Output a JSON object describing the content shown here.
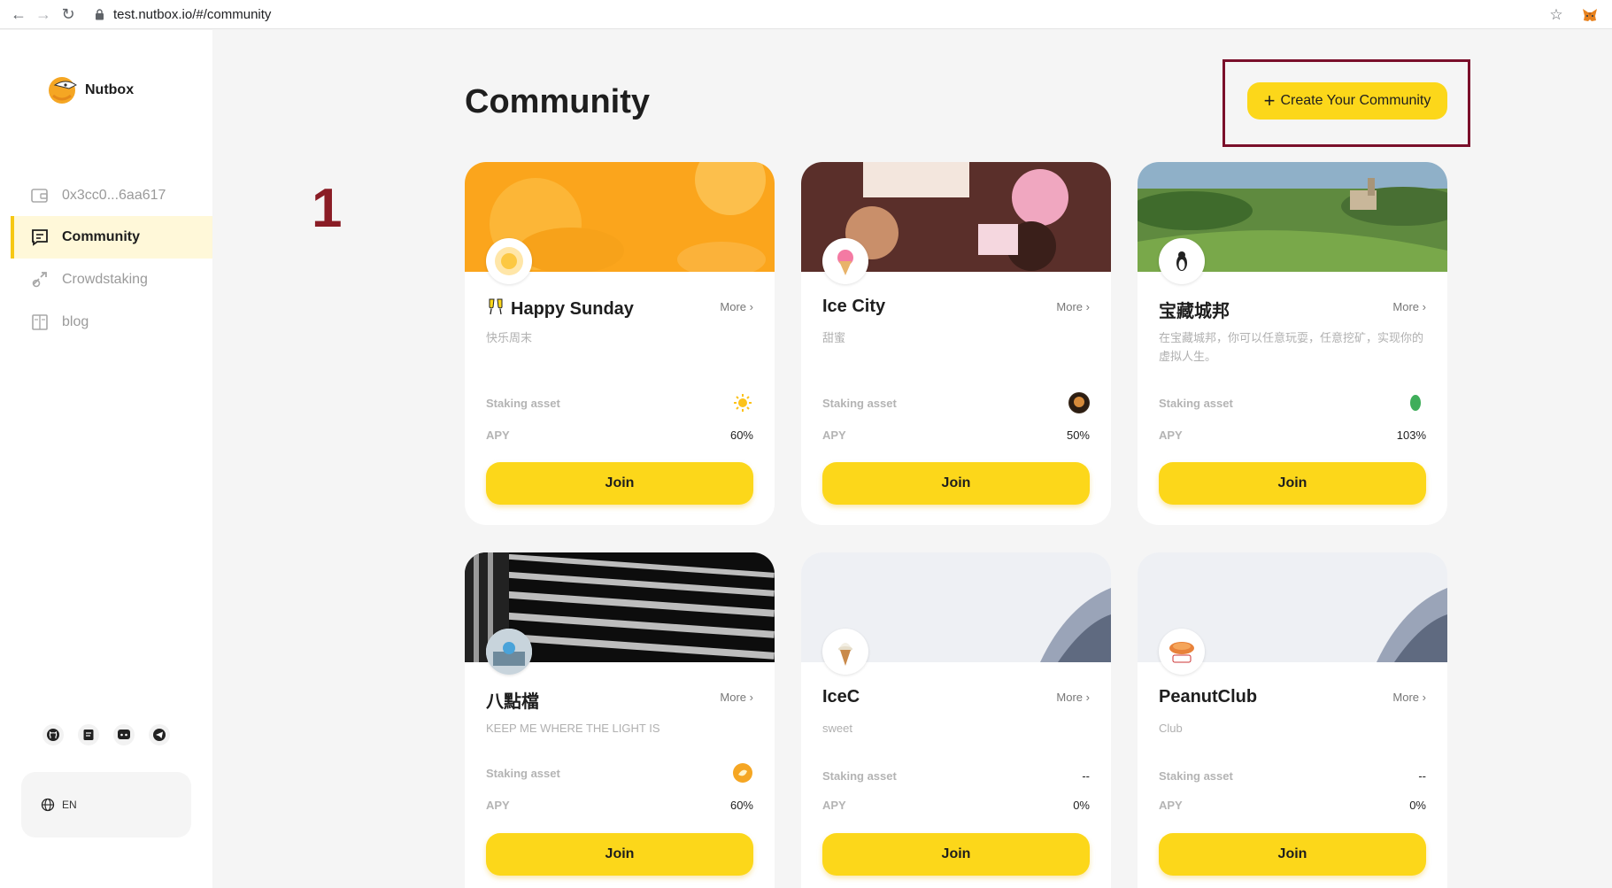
{
  "browser": {
    "url": "test.nutbox.io/#/community"
  },
  "sidebar": {
    "brand": "Nutbox",
    "items": [
      {
        "label": "0x3cc0...6aa617",
        "icon": "wallet-icon"
      },
      {
        "label": "Community",
        "icon": "community-icon",
        "active": true
      },
      {
        "label": "Crowdstaking",
        "icon": "crowdstaking-icon"
      },
      {
        "label": "blog",
        "icon": "blog-icon"
      }
    ],
    "socials": [
      "github-icon",
      "docs-icon",
      "discord-icon",
      "telegram-icon"
    ],
    "language": "EN"
  },
  "main": {
    "title": "Community",
    "create_button": "Create Your Community",
    "annotation_number": "1",
    "cards": [
      {
        "name": "Happy Sunday",
        "description": "快乐周末",
        "more": "More",
        "staking_label": "Staking asset",
        "staking_value": "",
        "apy_label": "APY",
        "apy": "60%",
        "join": "Join"
      },
      {
        "name": "Ice City",
        "description": "甜蜜",
        "more": "More",
        "staking_label": "Staking asset",
        "staking_value": "",
        "apy_label": "APY",
        "apy": "50%",
        "join": "Join"
      },
      {
        "name": "宝藏城邦",
        "description": "在宝藏城邦，你可以任意玩耍，任意挖矿，实现你的虚拟人生。",
        "more": "More",
        "staking_label": "Staking asset",
        "staking_value": "",
        "apy_label": "APY",
        "apy": "103%",
        "join": "Join"
      },
      {
        "name": "八點檔",
        "description": "KEEP ME WHERE THE LIGHT IS",
        "more": "More",
        "staking_label": "Staking asset",
        "staking_value": "",
        "apy_label": "APY",
        "apy": "60%",
        "join": "Join"
      },
      {
        "name": "IceC",
        "description": "sweet",
        "more": "More",
        "staking_label": "Staking asset",
        "staking_value": "--",
        "apy_label": "APY",
        "apy": "0%",
        "join": "Join"
      },
      {
        "name": "PeanutClub",
        "description": "Club",
        "more": "More",
        "staking_label": "Staking asset",
        "staking_value": "--",
        "apy_label": "APY",
        "apy": "0%",
        "join": "Join"
      }
    ]
  },
  "colors": {
    "accent": "#fcd71a",
    "annotation": "#8a1c25",
    "highlight_border": "#7a0f2a"
  }
}
